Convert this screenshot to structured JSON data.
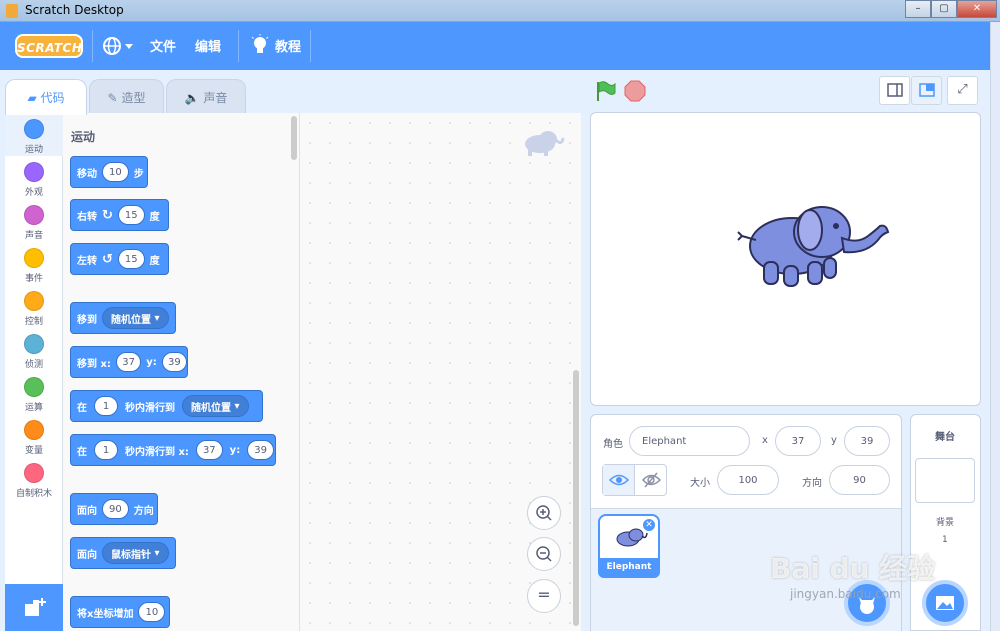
{
  "window": {
    "title": "Scratch Desktop"
  },
  "menubar": {
    "logo": "SCRATCH",
    "file": "文件",
    "edit": "编辑",
    "tutorials": "教程"
  },
  "tabs": [
    {
      "label": "代码"
    },
    {
      "label": "造型"
    },
    {
      "label": "声音"
    }
  ],
  "categories": [
    {
      "label": "运动",
      "color": "#4c97ff"
    },
    {
      "label": "外观",
      "color": "#9966ff"
    },
    {
      "label": "声音",
      "color": "#cf63cf"
    },
    {
      "label": "事件",
      "color": "#ffbf00"
    },
    {
      "label": "控制",
      "color": "#ffab19"
    },
    {
      "label": "侦测",
      "color": "#5cb1d6"
    },
    {
      "label": "运算",
      "color": "#59c059"
    },
    {
      "label": "变量",
      "color": "#ff8c1a"
    },
    {
      "label": "自制积木",
      "color": "#ff6680"
    }
  ],
  "palette": {
    "section_title": "运动",
    "blocks": {
      "move": {
        "a": "移动",
        "v": "10",
        "b": "步"
      },
      "turn_right": {
        "a": "右转",
        "v": "15",
        "b": "度"
      },
      "turn_left": {
        "a": "左转",
        "v": "15",
        "b": "度"
      },
      "goto": {
        "a": "移到",
        "dd": "随机位置"
      },
      "goto_xy": {
        "a": "移到 x:",
        "x": "37",
        "ylab": "y:",
        "y": "39"
      },
      "glide": {
        "a": "在",
        "v": "1",
        "b": "秒内滑行到",
        "dd": "随机位置"
      },
      "glide_xy": {
        "a": "在",
        "v": "1",
        "b": "秒内滑行到 x:",
        "x": "37",
        "ylab": "y:",
        "y": "39"
      },
      "point_dir": {
        "a": "面向",
        "v": "90",
        "b": "方向"
      },
      "point_towards": {
        "a": "面向",
        "dd": "鼠标指针"
      },
      "change_x": {
        "a": "将x坐标增加",
        "v": "10"
      }
    }
  },
  "sprite_info": {
    "sprite_label": "角色",
    "sprite_name": "Elephant",
    "x_label": "x",
    "x": "37",
    "y_label": "y",
    "y": "39",
    "size_label": "大小",
    "size": "100",
    "dir_label": "方向",
    "direction": "90"
  },
  "sprite_list": [
    {
      "name": "Elephant"
    }
  ],
  "stage_pane": {
    "title": "舞台",
    "backdrop_label": "背景",
    "backdrop_count": "1"
  },
  "watermark": {
    "brand": "Bai du 经验",
    "url": "jingyan.baidu.com"
  }
}
